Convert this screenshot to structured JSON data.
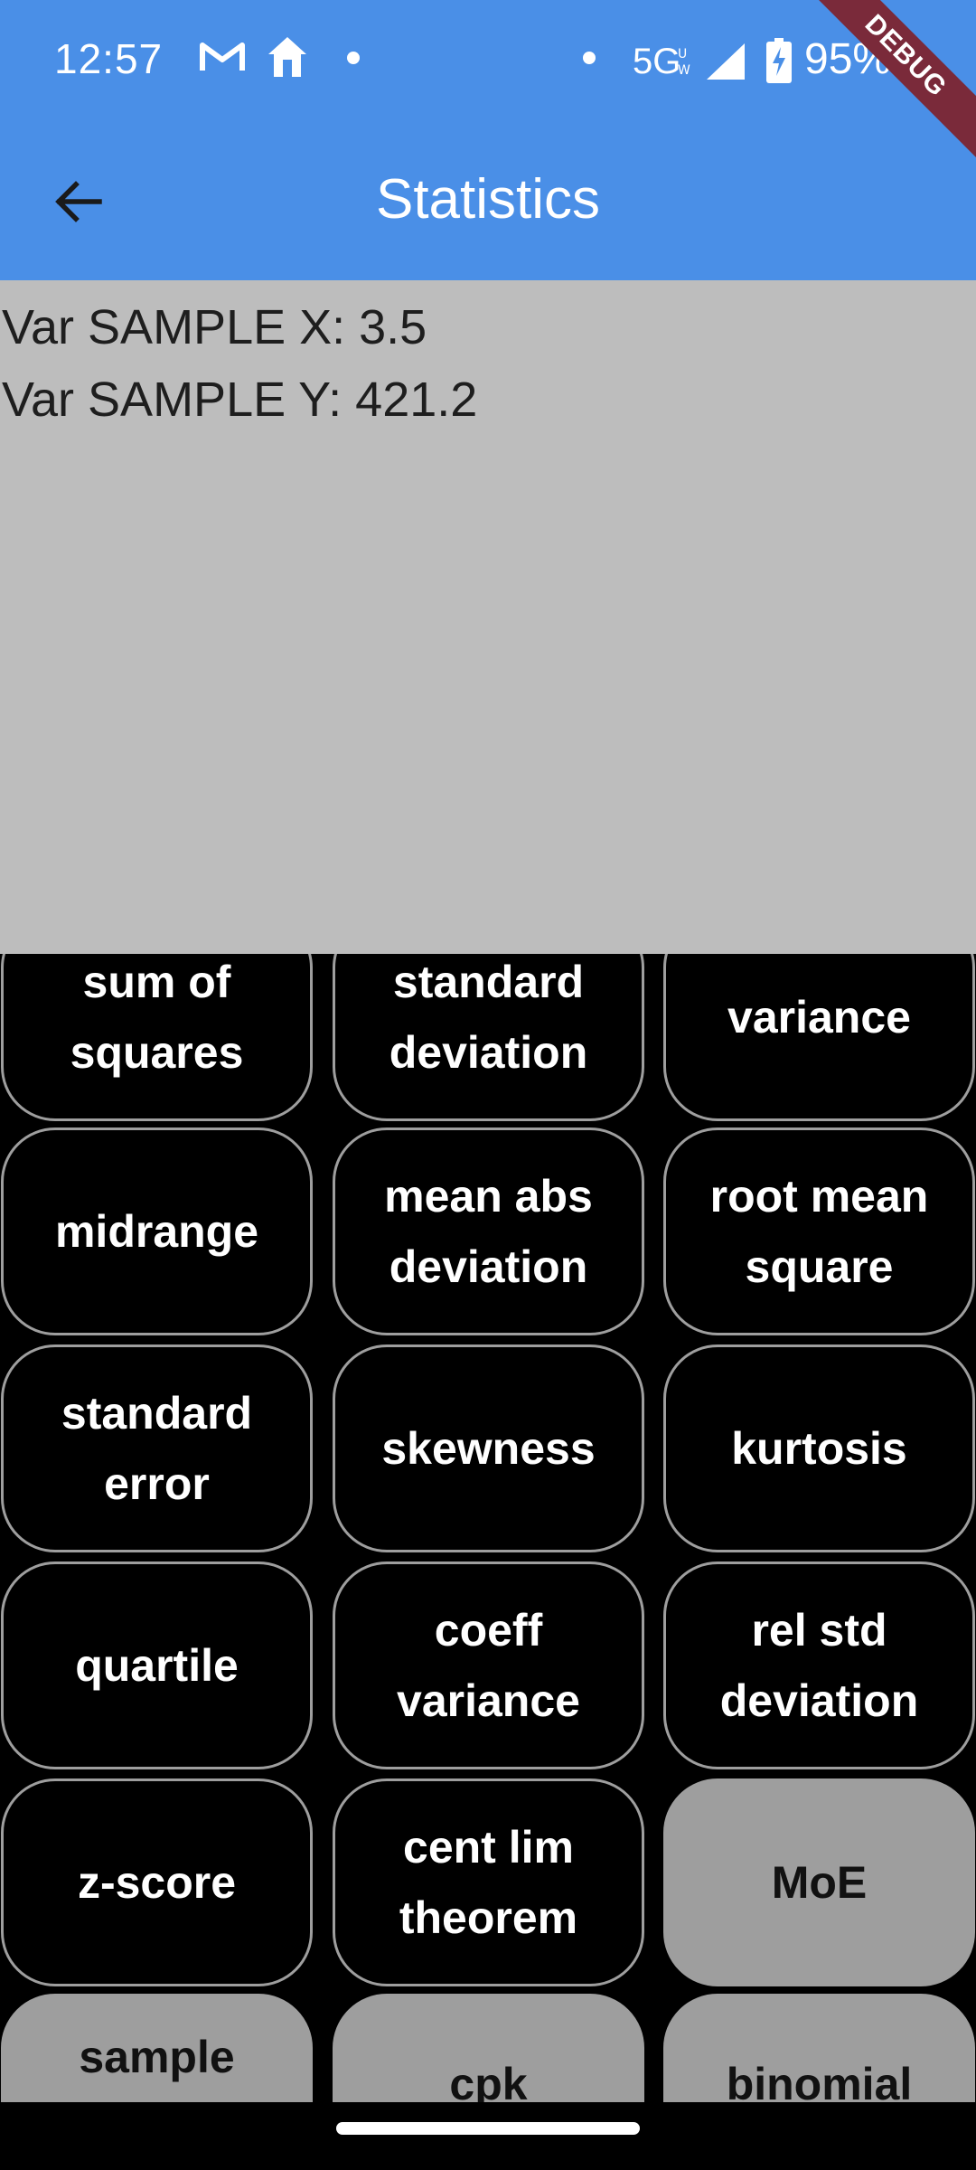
{
  "status_bar": {
    "time": "12:57",
    "network": "5G",
    "battery": "95%",
    "icons": [
      "gmail-icon",
      "home-icon",
      "dot-icon",
      "dot-icon",
      "signal-icon",
      "battery-charging-icon"
    ]
  },
  "debug_label": "DEBUG",
  "app_bar": {
    "title": "Statistics",
    "back_icon": "arrow-back-icon"
  },
  "output": {
    "line1": "Var SAMPLE X: 3.5",
    "line2": "Var SAMPLE Y: 421.2"
  },
  "buttons": [
    {
      "label": "sum of squares",
      "style": "dark"
    },
    {
      "label": "standard deviation",
      "style": "dark"
    },
    {
      "label": "variance",
      "style": "dark"
    },
    {
      "label": "midrange",
      "style": "dark"
    },
    {
      "label": "mean abs deviation",
      "style": "dark"
    },
    {
      "label": "root mean square",
      "style": "dark"
    },
    {
      "label": "standard error",
      "style": "dark"
    },
    {
      "label": "skewness",
      "style": "dark"
    },
    {
      "label": "kurtosis",
      "style": "dark"
    },
    {
      "label": "quartile",
      "style": "dark"
    },
    {
      "label": "coeff variance",
      "style": "dark"
    },
    {
      "label": "rel std deviation",
      "style": "dark"
    },
    {
      "label": "z-score",
      "style": "dark"
    },
    {
      "label": "cent lim theorem",
      "style": "dark"
    },
    {
      "label": "MoE",
      "style": "light"
    },
    {
      "label": "sample",
      "style": "light"
    },
    {
      "label": "cpk",
      "style": "light"
    },
    {
      "label": "binomial",
      "style": "light"
    }
  ],
  "colors": {
    "app_bar": "#4A8FE7",
    "output_bg": "#BDBDBD",
    "button_dark": "#000000",
    "button_light": "#9E9E9E"
  }
}
